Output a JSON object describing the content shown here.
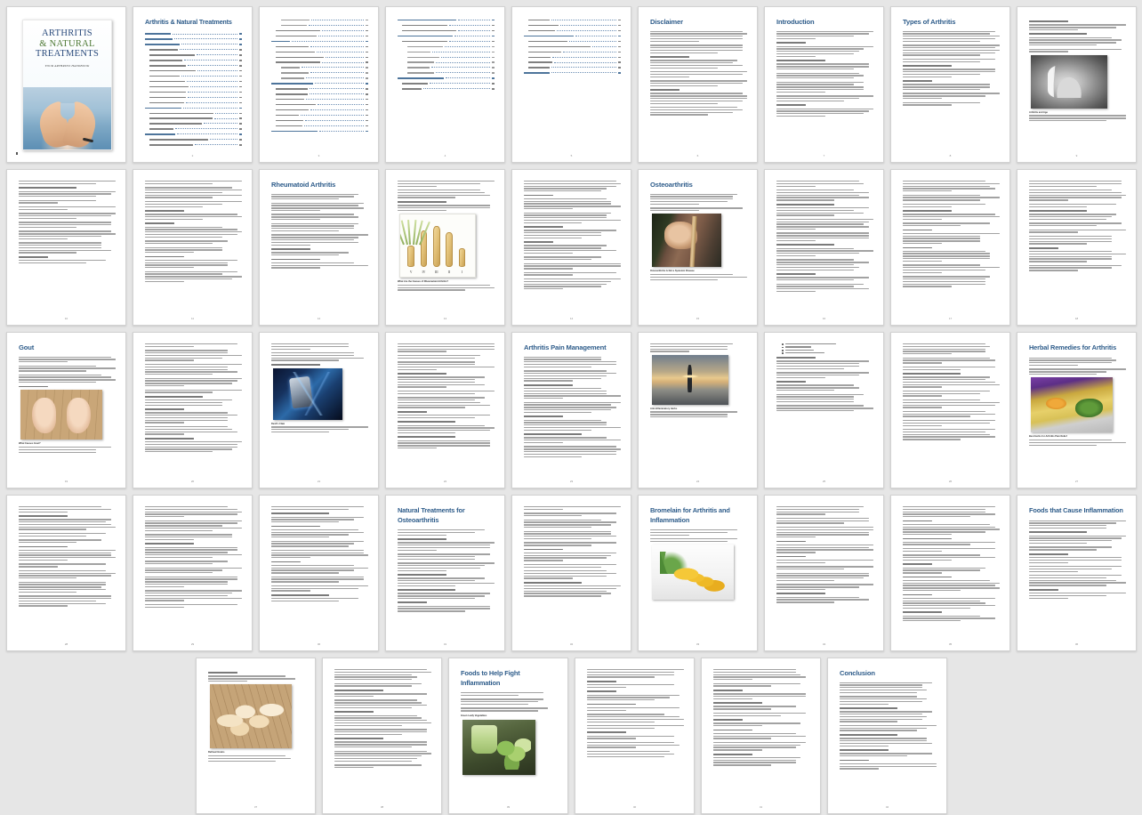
{
  "document": {
    "title": "Arthritis & Natural Treatments",
    "subtitle": "YOUR ARTHRITIS HANDBOOK",
    "cover_title_line1": "ARTHRITIS",
    "cover_title_line2": "& NATURAL",
    "cover_title_line3": "TREATMENTS",
    "cover_subtitle": "YOUR ARTHRITIS HANDBOOK",
    "total_pages": 42,
    "view": "thumbnail-grid",
    "background_color": "#e6e6e6",
    "heading_color": "#2e5c8a"
  },
  "toc": {
    "title": "Arthritis & Natural Treatments",
    "entries": [
      {
        "label": "Disclaimer",
        "page": "4",
        "level": 1
      },
      {
        "label": "Introduction",
        "page": "5",
        "level": 1
      },
      {
        "label": "Types of Arthritis",
        "page": "6",
        "level": 1
      },
      {
        "label": "How It Starts",
        "page": "6",
        "level": 2
      },
      {
        "label": "Different Types of Arthritis",
        "page": "6",
        "level": 2
      },
      {
        "label": "Arthritis and Age",
        "page": "7",
        "level": 2
      },
      {
        "label": "Rheumatoid Arthritis",
        "page": "7",
        "level": 2
      },
      {
        "label": "Juvenile Rheumatoid Arthritis",
        "page": "10",
        "level": 2
      },
      {
        "label": "Osteoarthritis",
        "page": "10",
        "level": 2
      },
      {
        "label": "Psoriatic Arthritis",
        "page": "10",
        "level": 2
      },
      {
        "label": "Ankylosing Spondylitis",
        "page": "11",
        "level": 2
      },
      {
        "label": "Pseudogout Arthritis",
        "page": "11",
        "level": 2
      },
      {
        "label": "Infectious Arthritis",
        "page": "11",
        "level": 2
      },
      {
        "label": "Reactive Arthritis",
        "page": "11",
        "level": 2
      },
      {
        "label": "Rheumatoid Arthritis",
        "page": "12",
        "level": 1
      },
      {
        "label": "What Are the Symptoms of Rheumatoid Arthritis?",
        "page": "12",
        "level": 2
      },
      {
        "label": "What Are the Causes of Rheumatoid Arthritis?",
        "page": "13",
        "level": 2
      },
      {
        "label": "What About Long Term Side Effects?",
        "page": "13",
        "level": 2
      },
      {
        "label": "Prognosis",
        "page": "14",
        "level": 2
      },
      {
        "label": "Osteoarthritis",
        "page": "15",
        "level": 1
      },
      {
        "label": "Osteoarthritis Is Not a Systemic Disease",
        "page": "15",
        "level": 2
      },
      {
        "label": "Symptoms of Osteoarthritis",
        "page": "16",
        "level": 2
      },
      {
        "label": "Pain",
        "page": "16",
        "level": 3
      },
      {
        "label": "Joint Stiffness",
        "page": "16",
        "level": 3
      },
      {
        "label": "Tenderness",
        "page": "16",
        "level": 3
      },
      {
        "label": "Swelling",
        "page": "16",
        "level": 3
      },
      {
        "label": "Grating Sound",
        "page": "17",
        "level": 3
      },
      {
        "label": "Bone Spurs",
        "page": "17",
        "level": 3
      },
      {
        "label": "Treatment of Osteoarthritis",
        "page": "17",
        "level": 2
      },
      {
        "label": "Causes of Osteoarthritis",
        "page": "17",
        "level": 2
      },
      {
        "label": "Gout",
        "page": "18",
        "level": 1
      },
      {
        "label": "What Causes Gout?",
        "page": "18",
        "level": 2
      },
      {
        "label": "What Are the Symptoms?",
        "page": "19",
        "level": 2
      },
      {
        "label": "Traditional Treatment for Gout",
        "page": "19",
        "level": 2
      },
      {
        "label": "Natural Treatments for Gout",
        "page": "19",
        "level": 2
      },
      {
        "label": "Diet",
        "page": "19",
        "level": 3
      },
      {
        "label": "Devil's Claw",
        "page": "20",
        "level": 3
      },
      {
        "label": "Exercise",
        "page": "20",
        "level": 3
      },
      {
        "label": "Arthritis Pain Management",
        "page": "21",
        "level": 1
      },
      {
        "label": "Reduce Your Diet",
        "page": "21",
        "level": 2
      },
      {
        "label": "Physical Therapy",
        "page": "21",
        "level": 2
      },
      {
        "label": "Heat and Cold",
        "page": "21",
        "level": 2
      },
      {
        "label": "Anti-Inflammatory Herbs",
        "page": "22",
        "level": 2
      },
      {
        "label": "Nutritional Herbs",
        "page": "22",
        "level": 2
      },
      {
        "label": "Dry Fish",
        "page": "23",
        "level": 2
      },
      {
        "label": "Antioxidants",
        "page": "23",
        "level": 2
      },
      {
        "label": "Weight Loss",
        "page": "23",
        "level": 2
      },
      {
        "label": "Herbal Remedies for Arthritis",
        "page": "24",
        "level": 1
      },
      {
        "label": "Bromelain for Arthritis and Inflammation",
        "page": "27",
        "level": 1
      },
      {
        "label": "Bromelain and Osteoarthritis",
        "page": "27",
        "level": 2
      },
      {
        "label": "Bromelain Helps Rheumatoid Arthritis",
        "page": "28",
        "level": 2
      },
      {
        "label": "Natural Treatments for Osteoarthritis",
        "page": "30",
        "level": 1
      },
      {
        "label": "Natural Arthritis Treatments",
        "page": "30",
        "level": 2
      },
      {
        "label": "Weight-Loss Efforts",
        "page": "30",
        "level": 3
      },
      {
        "label": "Exercise",
        "page": "31",
        "level": 3
      },
      {
        "label": "Physical Therapy",
        "page": "31",
        "level": 3
      },
      {
        "label": "Acupuncture",
        "page": "31",
        "level": 3
      },
      {
        "label": "Massage",
        "page": "31",
        "level": 3
      },
      {
        "label": "Supplements",
        "page": "32",
        "level": 3
      },
      {
        "label": "Foods that Cause Inflammation",
        "page": "34",
        "level": 1
      },
      {
        "label": "Trans Fats",
        "page": "34",
        "level": 2
      },
      {
        "label": "Sugar",
        "page": "34",
        "level": 2
      },
      {
        "label": "Gluten",
        "page": "35",
        "level": 2
      },
      {
        "label": "Refined Grains",
        "page": "35",
        "level": 2
      },
      {
        "label": "Dairy Foods",
        "page": "35",
        "level": 2
      },
      {
        "label": "Foods to Help Fight Inflammation",
        "page": "37",
        "level": 1
      },
      {
        "label": "Green Leafy Vegetables",
        "page": "37",
        "level": 2
      },
      {
        "label": "Fatty Fish That Contain Omega-3 Fatty Acids",
        "page": "38",
        "level": 2
      },
      {
        "label": "Soy \"Isoflavones\"",
        "page": "38",
        "level": 2
      },
      {
        "label": "Berries",
        "page": "38",
        "level": 2
      },
      {
        "label": "Green Tea",
        "page": "39",
        "level": 2
      },
      {
        "label": "Garlic",
        "page": "39",
        "level": 2
      },
      {
        "label": "Conclusion",
        "page": "42",
        "level": 1
      }
    ]
  },
  "pages": [
    {
      "num": 1,
      "kind": "cover",
      "heading": ""
    },
    {
      "num": 2,
      "kind": "toc-title",
      "heading": "Arthritis & Natural Treatments"
    },
    {
      "num": 3,
      "kind": "toc",
      "heading": ""
    },
    {
      "num": 4,
      "kind": "toc",
      "heading": ""
    },
    {
      "num": 5,
      "kind": "toc",
      "heading": ""
    },
    {
      "num": 6,
      "kind": "text",
      "heading": "Disclaimer"
    },
    {
      "num": 7,
      "kind": "text",
      "heading": "Introduction"
    },
    {
      "num": 8,
      "kind": "text",
      "heading": "Types of Arthritis"
    },
    {
      "num": 9,
      "kind": "photo-hand-gray",
      "heading": "",
      "caption": "Arthritis and Age"
    },
    {
      "num": 10,
      "kind": "text",
      "heading": ""
    },
    {
      "num": 11,
      "kind": "text",
      "heading": ""
    },
    {
      "num": 12,
      "kind": "text",
      "heading": "Rheumatoid Arthritis"
    },
    {
      "num": 13,
      "kind": "photo-bones",
      "heading": "",
      "caption": "What Are the Causes of Rheumatoid Arthritis?"
    },
    {
      "num": 14,
      "kind": "text",
      "heading": ""
    },
    {
      "num": 15,
      "kind": "photo-cane",
      "heading": "Osteoarthritis",
      "caption": "Osteoarthritis Is Not a Systemic Disease"
    },
    {
      "num": 16,
      "kind": "text",
      "heading": ""
    },
    {
      "num": 17,
      "kind": "text",
      "heading": ""
    },
    {
      "num": 18,
      "kind": "text",
      "heading": ""
    },
    {
      "num": 19,
      "kind": "photo-feet",
      "heading": "Gout",
      "caption": "What Causes Gout?"
    },
    {
      "num": 20,
      "kind": "text",
      "heading": ""
    },
    {
      "num": 21,
      "kind": "photo-tens",
      "heading": "",
      "caption": "Devil's Claw"
    },
    {
      "num": 22,
      "kind": "text",
      "heading": ""
    },
    {
      "num": 23,
      "kind": "text",
      "heading": "Arthritis Pain Management"
    },
    {
      "num": 24,
      "kind": "photo-yoga",
      "heading": "",
      "caption": "Anti-Inflammatory Herbs"
    },
    {
      "num": 25,
      "kind": "bullets",
      "heading": ""
    },
    {
      "num": 26,
      "kind": "text",
      "heading": ""
    },
    {
      "num": 27,
      "kind": "photo-herbs",
      "heading": "Herbal Remedies for Arthritis",
      "caption": "Best Herbs for Arthritis Pain Relief"
    },
    {
      "num": 28,
      "kind": "text",
      "heading": ""
    },
    {
      "num": 29,
      "kind": "text",
      "heading": ""
    },
    {
      "num": 30,
      "kind": "text",
      "heading": ""
    },
    {
      "num": 31,
      "kind": "text",
      "heading": "Natural Treatments for Osteoarthritis"
    },
    {
      "num": 32,
      "kind": "text",
      "heading": ""
    },
    {
      "num": 33,
      "kind": "photo-pineapple",
      "heading": "Bromelain for Arthritis and Inflammation",
      "caption": ""
    },
    {
      "num": 34,
      "kind": "text",
      "heading": ""
    },
    {
      "num": 35,
      "kind": "text",
      "heading": ""
    },
    {
      "num": 36,
      "kind": "text",
      "heading": "Foods that Cause Inflammation"
    },
    {
      "num": 37,
      "kind": "photo-pastry",
      "heading": "",
      "caption": "Refined Grains"
    },
    {
      "num": 38,
      "kind": "text",
      "heading": ""
    },
    {
      "num": 39,
      "kind": "photo-green",
      "heading": "Foods to Help Fight Inflammation",
      "caption": "Green Leafy Vegetables"
    },
    {
      "num": 40,
      "kind": "text",
      "heading": ""
    },
    {
      "num": 41,
      "kind": "text",
      "heading": ""
    },
    {
      "num": 42,
      "kind": "text",
      "heading": "Conclusion"
    }
  ],
  "rows": [
    [
      1,
      2,
      3,
      4,
      5,
      6,
      7,
      8,
      9
    ],
    [
      10,
      11,
      12,
      13,
      14,
      15,
      16,
      17,
      18
    ],
    [
      19,
      20,
      21,
      22,
      23,
      24,
      25,
      26,
      27
    ],
    [
      28,
      29,
      30,
      31,
      32,
      33,
      34,
      35,
      36
    ],
    [
      37,
      38,
      39,
      40,
      41,
      42
    ]
  ]
}
